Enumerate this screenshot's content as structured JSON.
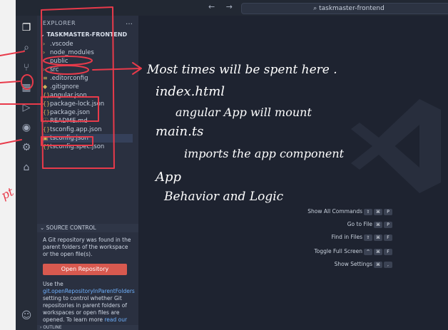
{
  "titlebar": {
    "search_text": "taskmaster-frontend",
    "nav_arrows": "← →"
  },
  "activity": {
    "icons": [
      "explorer-icon",
      "search-icon",
      "source-control-icon",
      "extensions-icon",
      "run-debug-icon",
      "remote-icon",
      "settings-icon",
      "test-icon",
      "accounts-icon"
    ]
  },
  "sidebar": {
    "title": "EXPLORER",
    "more": "…",
    "project": "TASKMASTER-FRONTEND",
    "files": [
      {
        "name": ".vscode"
      },
      {
        "name": "node_modules"
      },
      {
        "name": "public"
      },
      {
        "name": "src"
      },
      {
        "name": ".editorconfig"
      },
      {
        "name": ".gitignore"
      },
      {
        "name": "angular.json"
      },
      {
        "name": "package-lock.json"
      },
      {
        "name": "package.json"
      },
      {
        "name": "README.md"
      },
      {
        "name": "tsconfig.app.json"
      },
      {
        "name": "tsconfig.json"
      },
      {
        "name": "tsconfig.spec.json"
      }
    ],
    "source_control": {
      "title": "SOURCE CONTROL",
      "message": "A Git repository was found in the parent folders of the workspace or the open file(s).",
      "button": "Open Repository",
      "use_text": "Use the",
      "setting_link": "git.openRepositoryInParentFolders",
      "detail": "setting to control whether Git repositories in parent folders of workspaces or open files are opened. To learn more",
      "read_more": "read our"
    },
    "outline": "OUTLINE"
  },
  "editor": {
    "shortcuts": [
      {
        "label": "Show All Commands",
        "keys": [
          "⇧",
          "⌘",
          "P"
        ]
      },
      {
        "label": "Go to File",
        "keys": [
          "⌘",
          "P"
        ]
      },
      {
        "label": "Find in Files",
        "keys": [
          "⇧",
          "⌘",
          "F"
        ]
      },
      {
        "label": "Toggle Full Screen",
        "keys": [
          "^",
          "⌘",
          "F"
        ]
      },
      {
        "label": "Show Settings",
        "keys": [
          "⌘",
          ","
        ]
      }
    ]
  },
  "annotations": {
    "line1": "Most times will be spent here .",
    "line2": "index.html",
    "line3": "angular App will mount",
    "line4": "main.ts",
    "line5": "imports the app component",
    "line6": "App",
    "line7": "Behavior and Logic",
    "margin_mark": "pt"
  },
  "colors": {
    "annotation_red": "#e83a4a",
    "button": "#d8594f",
    "accent": "#6fb2ff"
  }
}
